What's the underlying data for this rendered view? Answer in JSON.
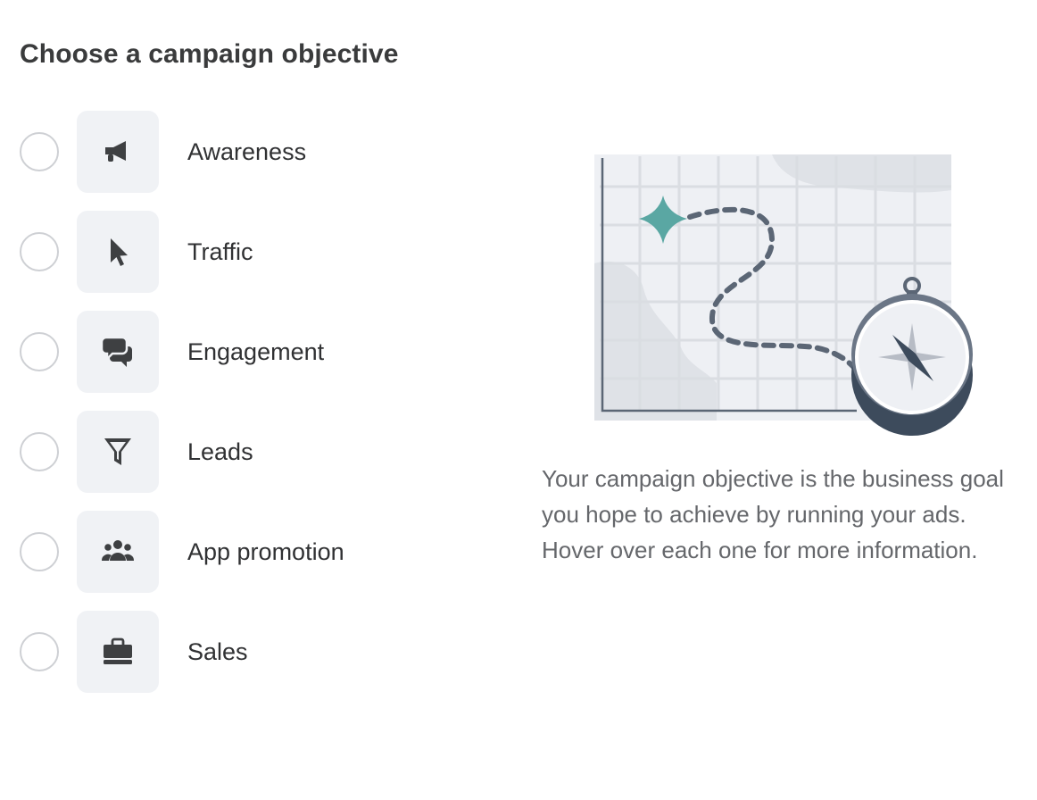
{
  "page": {
    "title": "Choose a campaign objective",
    "description": "Your campaign objective is the business goal you hope to achieve by running your ads. Hover over each one for more information."
  },
  "objectives": [
    {
      "label": "Awareness",
      "icon": "megaphone-icon",
      "selected": false
    },
    {
      "label": "Traffic",
      "icon": "cursor-icon",
      "selected": false
    },
    {
      "label": "Engagement",
      "icon": "chat-bubbles-icon",
      "selected": false
    },
    {
      "label": "Leads",
      "icon": "funnel-icon",
      "selected": false
    },
    {
      "label": "App promotion",
      "icon": "people-icon",
      "selected": false
    },
    {
      "label": "Sales",
      "icon": "shopping-bag-icon",
      "selected": false
    }
  ],
  "colors": {
    "icon": "#3e4042",
    "icon_background": "#f0f2f5",
    "radio_border": "#ced0d4",
    "map_accent": "#5aa7a3",
    "compass": "#3d4b5c"
  }
}
